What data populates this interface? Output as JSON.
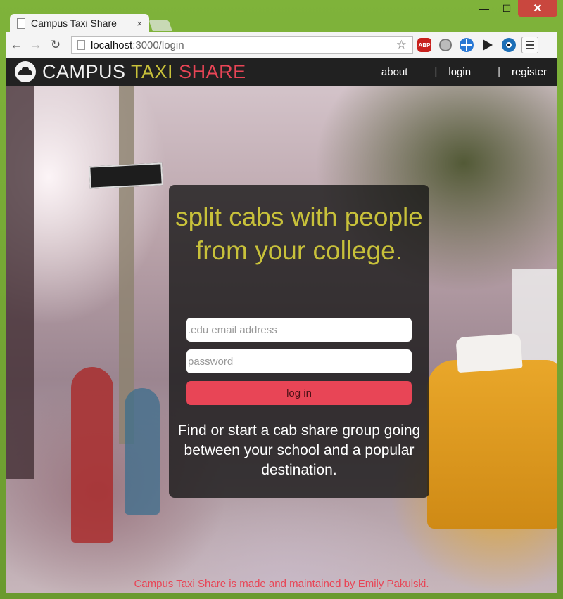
{
  "browser": {
    "tab_title": "Campus Taxi Share",
    "tab_close": "×",
    "url_host": "localhost",
    "url_path": ":3000/login",
    "window_minimize": "—",
    "window_maximize": "☐",
    "window_close": "✕",
    "back": "←",
    "forward": "→",
    "reload": "↻",
    "star": "☆",
    "extensions": [
      "abp-icon",
      "flame-icon",
      "globe-icon",
      "play-off-icon",
      "eye-icon"
    ],
    "abp_label": "ABP"
  },
  "site": {
    "logo_word1": "CAMPUS",
    "logo_word2": "TAXI",
    "logo_word3": "SHARE",
    "nav": {
      "about": "about",
      "sep1": "|",
      "login": "login",
      "sep2": "|",
      "register": "register"
    },
    "colors": {
      "accent_yellow": "#c8c13a",
      "accent_red": "#e84556",
      "header_bg": "#212121"
    }
  },
  "login_card": {
    "headline": "split cabs with people from your college.",
    "email_placeholder": ".edu email address",
    "password_placeholder": "password",
    "login_button": "log in",
    "tagline": "Find or start a cab share group going between your school and a popular destination."
  },
  "footer": {
    "text": "Campus Taxi Share is made and maintained by ",
    "author": "Emily Pakulski",
    "period": "."
  }
}
